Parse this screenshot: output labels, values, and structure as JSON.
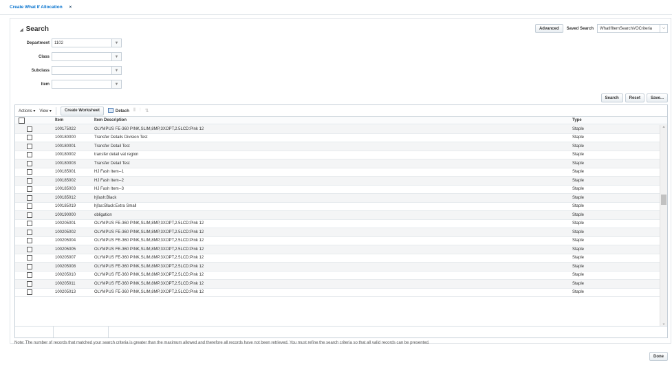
{
  "tab": {
    "title": "Create What If Allocation",
    "close": "×"
  },
  "search": {
    "title": "Search",
    "advanced_label": "Advanced",
    "saved_search_label": "Saved Search",
    "saved_search_value": "WhatIfItemSearchVOCriteria",
    "fields": [
      {
        "label": "Department",
        "value": "1102"
      },
      {
        "label": "Class",
        "value": ""
      },
      {
        "label": "Subclass",
        "value": ""
      },
      {
        "label": "Item",
        "value": ""
      }
    ],
    "search_btn": "Search",
    "reset_btn": "Reset",
    "save_btn": "Save..."
  },
  "toolbar": {
    "actions": "Actions ▾",
    "view": "View ▾",
    "create_worksheet": "Create Worksheet",
    "detach": "Detach"
  },
  "table": {
    "headers": {
      "item": "Item",
      "desc": "Item Description",
      "type": "Type"
    },
    "rows": [
      {
        "item": "100175022",
        "desc": "OLYMPUS FE-360 PINK,SLIM,8MP,3XOPT,2.5LCD:Pink 12",
        "type": "Staple"
      },
      {
        "item": "100180000",
        "desc": "Transfer Details Division Test",
        "type": "Staple"
      },
      {
        "item": "100180001",
        "desc": "Transfer Detail Test",
        "type": "Staple"
      },
      {
        "item": "100180002",
        "desc": "transfer detail vat region",
        "type": "Staple"
      },
      {
        "item": "100180003",
        "desc": "Transfer Detail Test",
        "type": "Staple"
      },
      {
        "item": "100185001",
        "desc": "HJ Fash Item--1",
        "type": "Staple"
      },
      {
        "item": "100185002",
        "desc": "HJ Fash Item--2",
        "type": "Staple"
      },
      {
        "item": "100185003",
        "desc": "HJ Fash Item--3",
        "type": "Staple"
      },
      {
        "item": "100185012",
        "desc": "hjfash:Black",
        "type": "Staple"
      },
      {
        "item": "100185019",
        "desc": "hjfas:Black:Extra Small",
        "type": "Staple"
      },
      {
        "item": "100190000",
        "desc": "obligation",
        "type": "Staple"
      },
      {
        "item": "100205001",
        "desc": "OLYMPUS FE-360 PINK,SLIM,8MP,3XOPT,2.5LCD:Pink 12",
        "type": "Staple"
      },
      {
        "item": "100205002",
        "desc": "OLYMPUS FE-360 PINK,SLIM,8MP,3XOPT,2.5LCD:Pink 12",
        "type": "Staple"
      },
      {
        "item": "100205004",
        "desc": "OLYMPUS FE-360 PINK,SLIM,8MP,3XOPT,2.5LCD:Pink 12",
        "type": "Staple"
      },
      {
        "item": "100205005",
        "desc": "OLYMPUS FE-360 PINK,SLIM,8MP,3XOPT,2.5LCD:Pink 12",
        "type": "Staple"
      },
      {
        "item": "100205007",
        "desc": "OLYMPUS FE-360 PINK,SLIM,8MP,3XOPT,2.5LCD:Pink 12",
        "type": "Staple"
      },
      {
        "item": "100205008",
        "desc": "OLYMPUS FE-360 PINK,SLIM,8MP,3XOPT,2.5LCD:Pink 12",
        "type": "Staple"
      },
      {
        "item": "100205010",
        "desc": "OLYMPUS FE-360 PINK,SLIM,8MP,3XOPT,2.5LCD:Pink 12",
        "type": "Staple"
      },
      {
        "item": "100205011",
        "desc": "OLYMPUS FE-360 PINK,SLIM,8MP,3XOPT,2.5LCD:Pink 12",
        "type": "Staple"
      },
      {
        "item": "100205013",
        "desc": "OLYMPUS FE-360 PINK,SLIM,8MP,3XOPT,2.5LCD:Pink 12",
        "type": "Staple"
      }
    ]
  },
  "note": "Note: The number of records that matched your search criteria is greater than the maximum allowed and therefore all records have not been retrieved. You must refine the search criteria so that all valid records can be presented.",
  "done_btn": "Done",
  "colors": {
    "link": "#0572ce",
    "border": "#c4ced7",
    "row_alt": "#f4f5f6"
  }
}
